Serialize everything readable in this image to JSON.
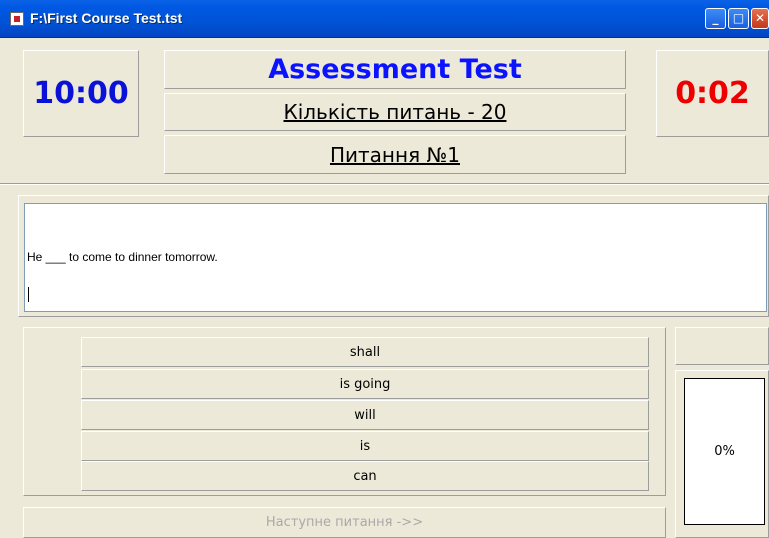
{
  "window": {
    "title": "F:\\First Course Test.tst",
    "controls": {
      "minimize": "_",
      "maximize": "□",
      "close": "✕"
    }
  },
  "header": {
    "time_limit": "10:00",
    "elapsed": "0:02",
    "title": "Assessment Test",
    "question_count": "Кількість питань - 20",
    "question_number": "Питання №1"
  },
  "question": {
    "text": "He ___ to come to dinner tomorrow."
  },
  "answers": [
    {
      "label": "shall"
    },
    {
      "label": "is going"
    },
    {
      "label": "will"
    },
    {
      "label": "is"
    },
    {
      "label": "can"
    }
  ],
  "next_button": {
    "label": "Наступне питання ->>",
    "enabled": false
  },
  "progress": {
    "label": "0%",
    "value": 0
  },
  "colors": {
    "title_blue": "#0a12ff",
    "timer_blue": "#0a12d8",
    "timer_red": "#ee0000",
    "disabled_text": "#a9a9a9"
  }
}
